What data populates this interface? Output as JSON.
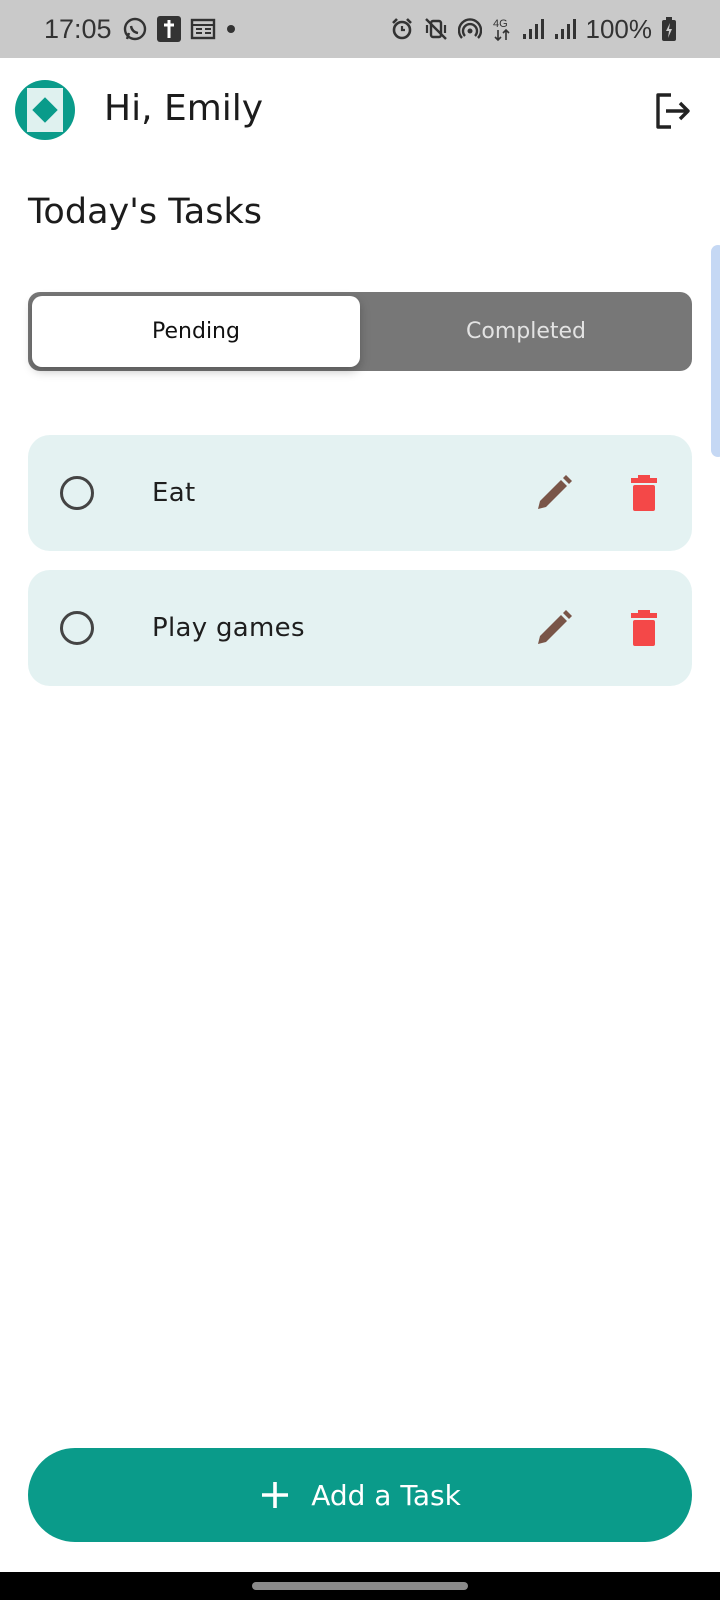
{
  "status_bar": {
    "time": "17:05",
    "battery": "100%",
    "network": "4G"
  },
  "header": {
    "greeting": "Hi, Emily",
    "logout_icon": "logout-icon"
  },
  "page": {
    "title": "Today's Tasks"
  },
  "tabs": {
    "items": [
      {
        "label": "Pending",
        "active": true
      },
      {
        "label": "Completed",
        "active": false
      }
    ]
  },
  "tasks": [
    {
      "label": "Eat",
      "completed": false
    },
    {
      "label": "Play games",
      "completed": false
    }
  ],
  "add_button": {
    "label": "Add a Task",
    "icon": "plus-icon"
  },
  "colors": {
    "accent": "#0a9b8a",
    "task_bg": "#e4f2f2",
    "edit": "#795548",
    "delete": "#f44848",
    "segment_bg": "#777777"
  }
}
